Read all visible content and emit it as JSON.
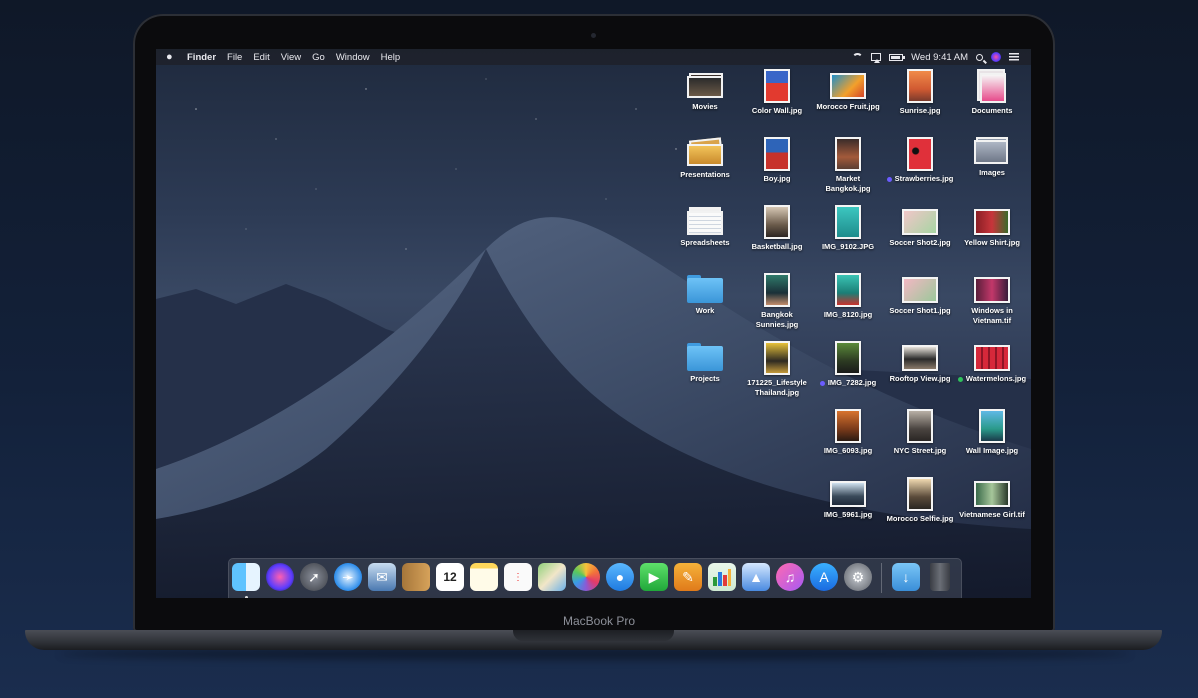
{
  "device": {
    "brand": "MacBook Pro"
  },
  "menubar": {
    "items": [
      "Finder",
      "File",
      "Edit",
      "View",
      "Go",
      "Window",
      "Help"
    ],
    "clock": "Wed 9:41 AM",
    "status_icons": [
      "wifi-icon",
      "airplay-icon",
      "battery-icon",
      "spotlight-icon",
      "siri-icon",
      "notification-center-icon"
    ]
  },
  "desktop": {
    "icons": [
      {
        "label": "Movies"
      },
      {
        "label": "Color Wall.jpg"
      },
      {
        "label": "Morocco Fruit.jpg"
      },
      {
        "label": "Sunrise.jpg"
      },
      {
        "label": "Documents"
      },
      {
        "label": "Presentations"
      },
      {
        "label": "Boy.jpg"
      },
      {
        "label": "Market Bangkok.jpg"
      },
      {
        "label": "Strawberries.jpg",
        "tag": "#6b5cff"
      },
      {
        "label": "Images"
      },
      {
        "label": "Spreadsheets"
      },
      {
        "label": "Basketball.jpg"
      },
      {
        "label": "IMG_9102.JPG"
      },
      {
        "label": "Soccer Shot2.jpg"
      },
      {
        "label": "Yellow Shirt.jpg"
      },
      {
        "label": "Work"
      },
      {
        "label": "Bangkok Sunnies.jpg"
      },
      {
        "label": "IMG_8120.jpg"
      },
      {
        "label": "Soccer Shot1.jpg"
      },
      {
        "label": "Windows in Vietnam.tif"
      },
      {
        "label": "Projects"
      },
      {
        "label": "171225_Lifestyle Thailand.jpg"
      },
      {
        "label": "IMG_7282.jpg",
        "tag": "#6b5cff"
      },
      {
        "label": "Rooftop View.jpg"
      },
      {
        "label": "Watermelons.jpg",
        "tag": "#2fc25b"
      },
      {
        "label": "IMG_6093.jpg"
      },
      {
        "label": "NYC Street.jpg"
      },
      {
        "label": "Wall Image.jpg"
      },
      {
        "label": "IMG_5961.jpg"
      },
      {
        "label": "Morocco Selfie.jpg"
      },
      {
        "label": "Vietnamese Girl.tif"
      }
    ]
  },
  "dock": {
    "apps": [
      "finder-icon",
      "siri-icon",
      "launchpad-icon",
      "safari-icon",
      "mail-icon",
      "contacts-icon",
      "calendar-icon",
      "notes-icon",
      "reminders-icon",
      "maps-icon",
      "photos-icon",
      "messages-icon",
      "facetime-icon",
      "pages-icon",
      "numbers-icon",
      "keynote-icon",
      "itunes-icon",
      "app-store-icon",
      "system-preferences-icon",
      "downloads-folder-icon",
      "trash-icon"
    ],
    "calendar_day": "12"
  }
}
